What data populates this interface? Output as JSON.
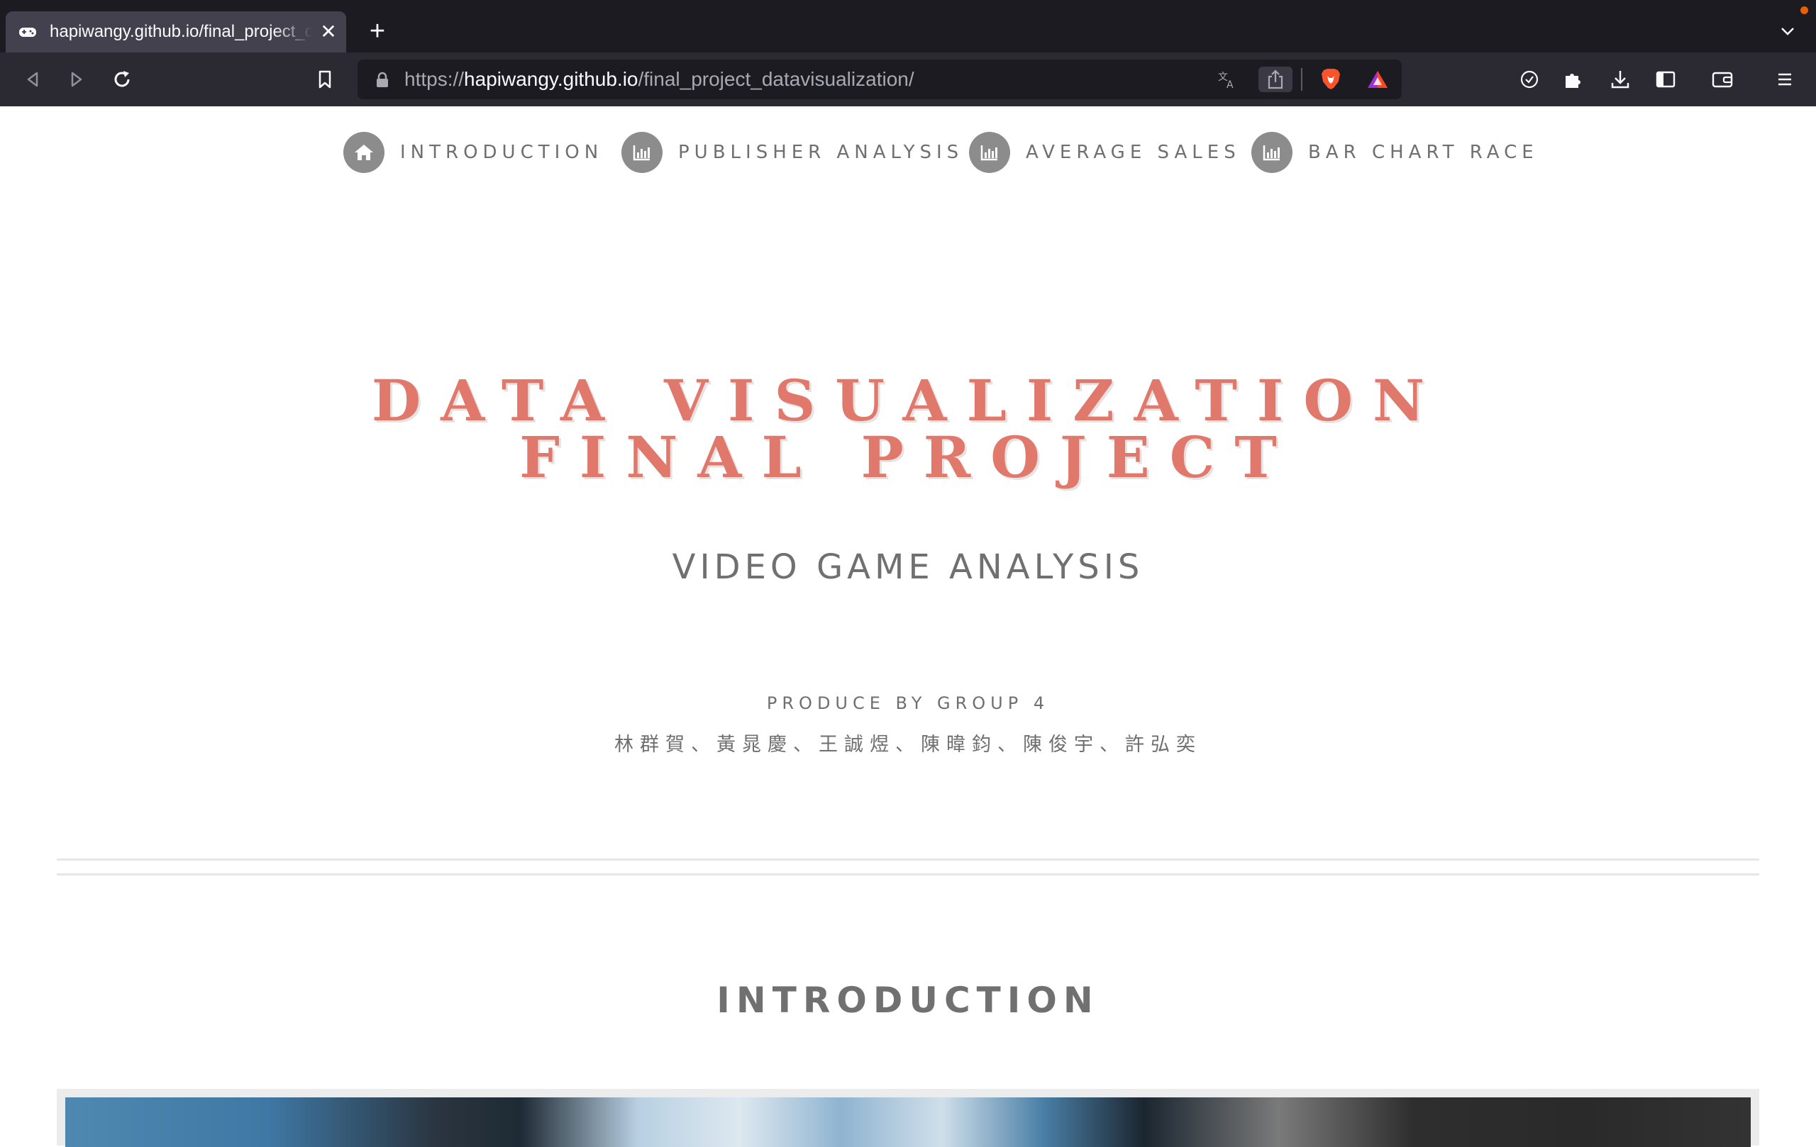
{
  "browser": {
    "tab_title": "hapiwangy.github.io/final_project_datavisualization/",
    "new_tab_icon": "plus-icon",
    "url_prefix": "https://",
    "url_host": "hapiwangy.github.io",
    "url_path": "/final_project_datavisualization/",
    "accent_colors": {
      "notification_dot": "#e66000",
      "brave_lion": "#fb542b"
    }
  },
  "site_nav": {
    "items": [
      {
        "label": "INTRODUCTION",
        "icon": "home-icon"
      },
      {
        "label": "PUBLISHER ANALYSIS",
        "icon": "bar-chart-icon"
      },
      {
        "label": "AVERAGE SALES",
        "icon": "bar-chart-icon"
      },
      {
        "label": "BAR CHART RACE",
        "icon": "bar-chart-icon"
      }
    ]
  },
  "hero": {
    "title_line1": "DATA VISUALIZATION",
    "title_line2": "FINAL PROJECT",
    "subtitle": "VIDEO GAME ANALYSIS",
    "produce": "PRODUCE BY GROUP 4",
    "members": "林群賀、黃晁慶、王誠煜、陳暐鈞、陳俊宇、許弘奕"
  },
  "intro": {
    "section_title": "INTRODUCTION"
  },
  "theme": {
    "title_color": "#e0786b",
    "text_color": "#707070",
    "nav_circle_color": "#8c8c8c"
  }
}
